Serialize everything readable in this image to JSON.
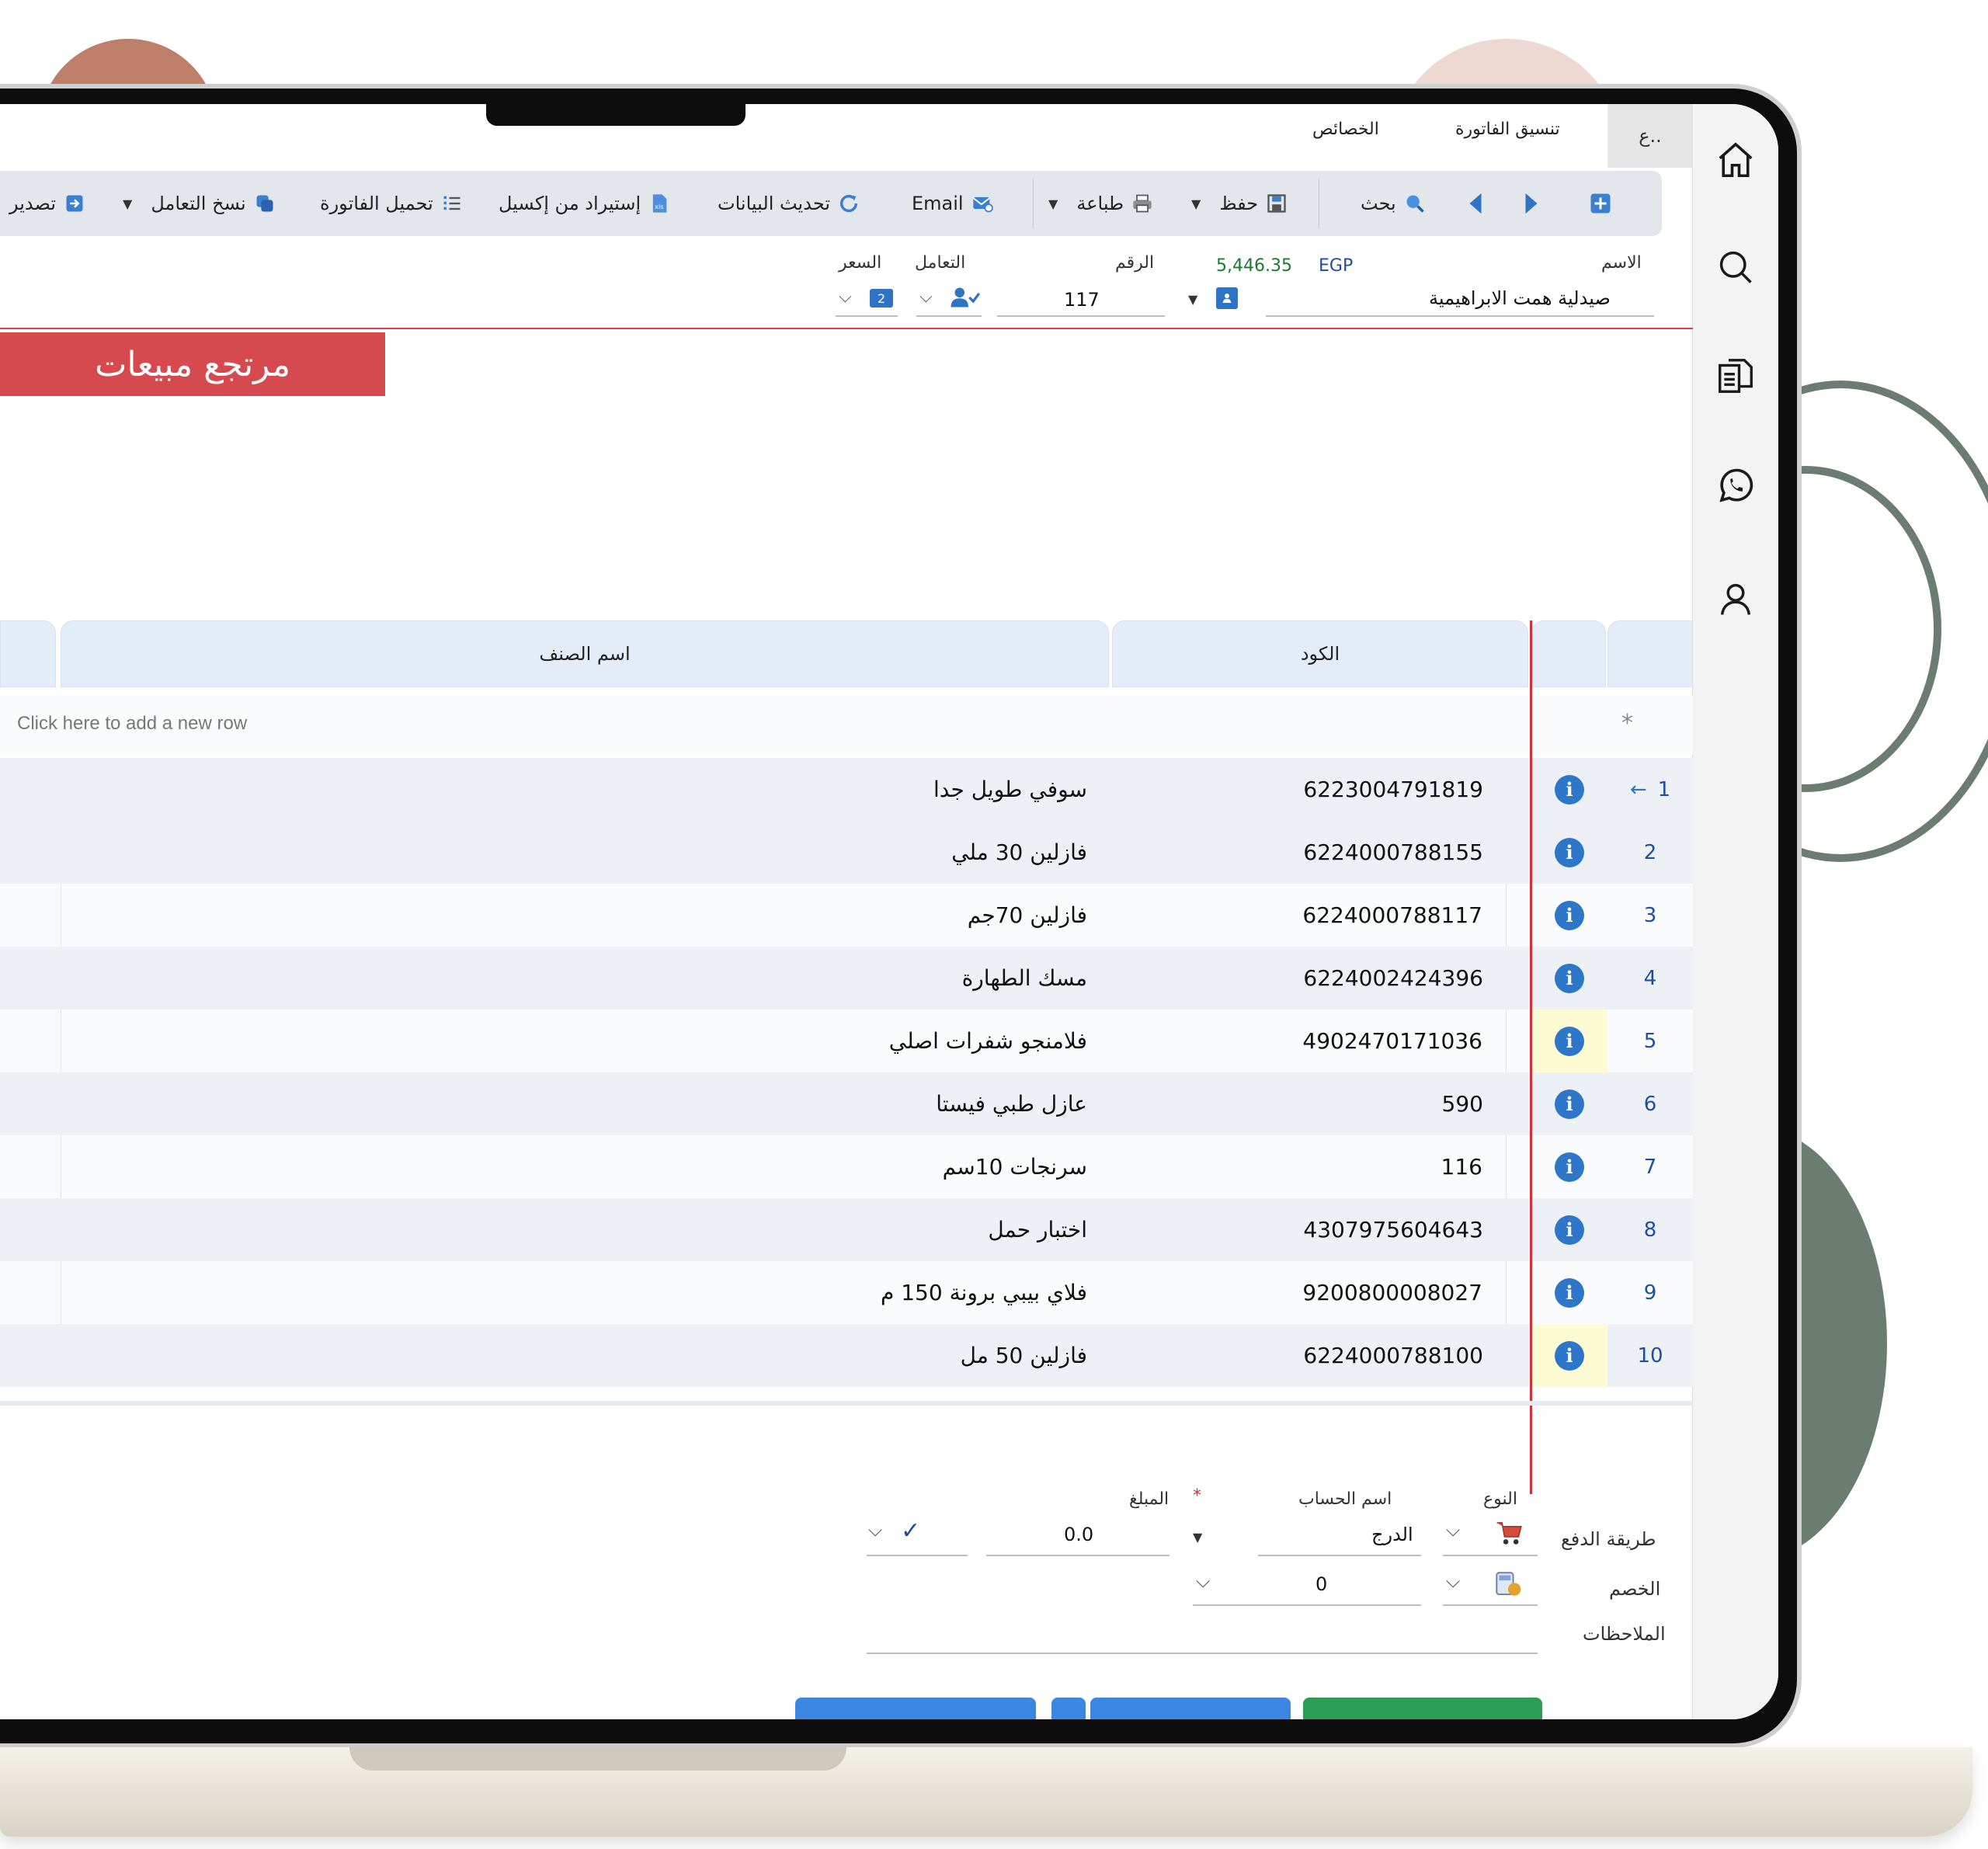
{
  "ribbon": {
    "tab_first": "ع..",
    "tabs": [
      "تنسيق الفاتورة",
      "الخصائص"
    ]
  },
  "toolbar": {
    "search": "بحث",
    "save": "حفظ",
    "print": "طباعة",
    "email": "Email",
    "refresh": "تحديث البيانات",
    "import_excel": "إستيراد من إكسيل",
    "load_invoice": "تحميل الفاتورة",
    "copy_transaction": "نسخ التعامل",
    "export": "تصدير"
  },
  "header": {
    "name_label": "الاسم",
    "name_value": "صيدلية همت الابراهيمية",
    "balance_currency": "EGP",
    "balance_value": "5,446.35",
    "number_label": "الرقم",
    "number_value": "117",
    "dealing_label": "التعامل",
    "price_label": "السعر",
    "price_badge": "2"
  },
  "invoice_title": "مرتجع مبيعات",
  "grid": {
    "columns": [
      "الكود",
      "اسم الصنف"
    ],
    "new_row_hint": "Click here to add a new row",
    "new_row_marker": "*",
    "current_marker": "←",
    "rows": [
      {
        "num": "1",
        "code": "6223004791819",
        "name": "سوفي طويل جدا"
      },
      {
        "num": "2",
        "code": "6224000788155",
        "name": "فازلين 30 ملي"
      },
      {
        "num": "3",
        "code": "6224000788117",
        "name": "فازلين 70جم"
      },
      {
        "num": "4",
        "code": "6224002424396",
        "name": "مسك الطهارة"
      },
      {
        "num": "5",
        "code": "4902470171036",
        "name": "فلامنجو شفرات اصلي"
      },
      {
        "num": "6",
        "code": "590",
        "name": "عازل طبي فيستا"
      },
      {
        "num": "7",
        "code": "116",
        "name": "سرنجات 10سم"
      },
      {
        "num": "8",
        "code": "4307975604643",
        "name": "اختبار حمل"
      },
      {
        "num": "9",
        "code": "9200800008027",
        "name": "فلاي بيبي برونة 150 م"
      },
      {
        "num": "10",
        "code": "6224000788100",
        "name": "فازلين 50 مل"
      }
    ]
  },
  "payment": {
    "type_label": "النوع",
    "account_label": "اسم الحساب",
    "amount_label": "المبلغ",
    "required_mark": "*",
    "method_label": "طريقة الدفع",
    "account_value": "الدرج",
    "amount_value": "0.0",
    "discount_label": "الخصم",
    "discount_value": "0",
    "notes_label": "الملاحظات"
  },
  "colors": {
    "accent_red": "#d5494f",
    "grid_header": "#e4ecf8",
    "link_blue": "#1f4f9c",
    "info_blue": "#2e76c8",
    "highlight_yellow": "#fdfbd3"
  }
}
